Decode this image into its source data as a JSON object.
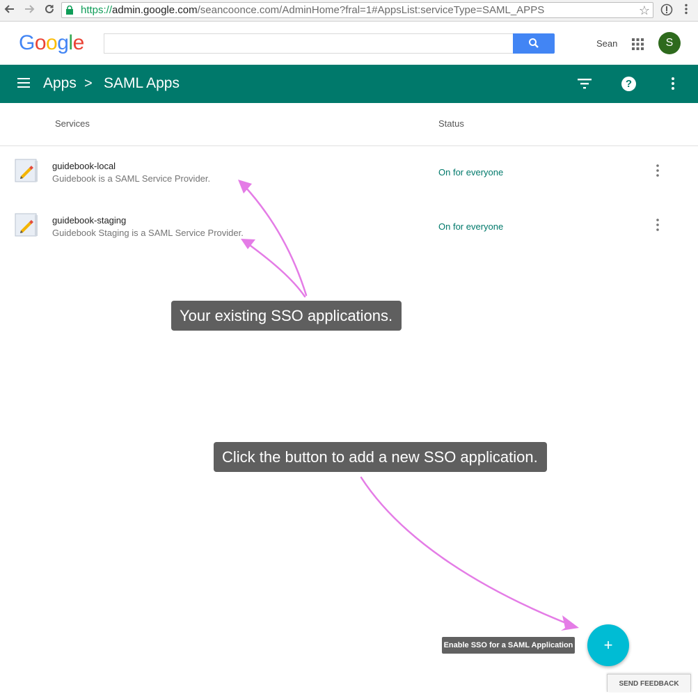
{
  "browser": {
    "url_scheme": "https://",
    "url_host": "admin.google.com",
    "url_path": "/seancoonce.com/AdminHome?fral=1#AppsList:serviceType=SAML_APPS"
  },
  "header": {
    "logo_letters": [
      {
        "char": "G",
        "color": "#4285f4"
      },
      {
        "char": "o",
        "color": "#ea4335"
      },
      {
        "char": "o",
        "color": "#fbbc05"
      },
      {
        "char": "g",
        "color": "#4285f4"
      },
      {
        "char": "l",
        "color": "#34a853"
      },
      {
        "char": "e",
        "color": "#ea4335"
      }
    ],
    "search_value": "",
    "user_name": "Sean",
    "avatar_letter": "S"
  },
  "appbar": {
    "crumb_apps": "Apps",
    "crumb_separator": ">",
    "crumb_current": "SAML Apps",
    "help_glyph": "?"
  },
  "table": {
    "col_services": "Services",
    "col_status": "Status",
    "rows": [
      {
        "name": "guidebook-local",
        "description": "Guidebook is a SAML Service Provider.",
        "status": "On for everyone"
      },
      {
        "name": "guidebook-staging",
        "description": "Guidebook Staging is a SAML Service Provider.",
        "status": "On for everyone"
      }
    ]
  },
  "annotations": {
    "existing_apps": "Your existing SSO applications.",
    "add_button_hint": "Click the button to add a new SSO application.",
    "arrow_color": "#e47ce6"
  },
  "fab": {
    "tooltip": "Enable SSO for a SAML Application",
    "glyph": "+"
  },
  "feedback": {
    "label": "SEND FEEDBACK"
  },
  "colors": {
    "appbar": "#00796b",
    "status_text": "#00796b",
    "fab": "#00bcd4",
    "search_button": "#4285f4",
    "avatar": "#2e6a1d"
  }
}
